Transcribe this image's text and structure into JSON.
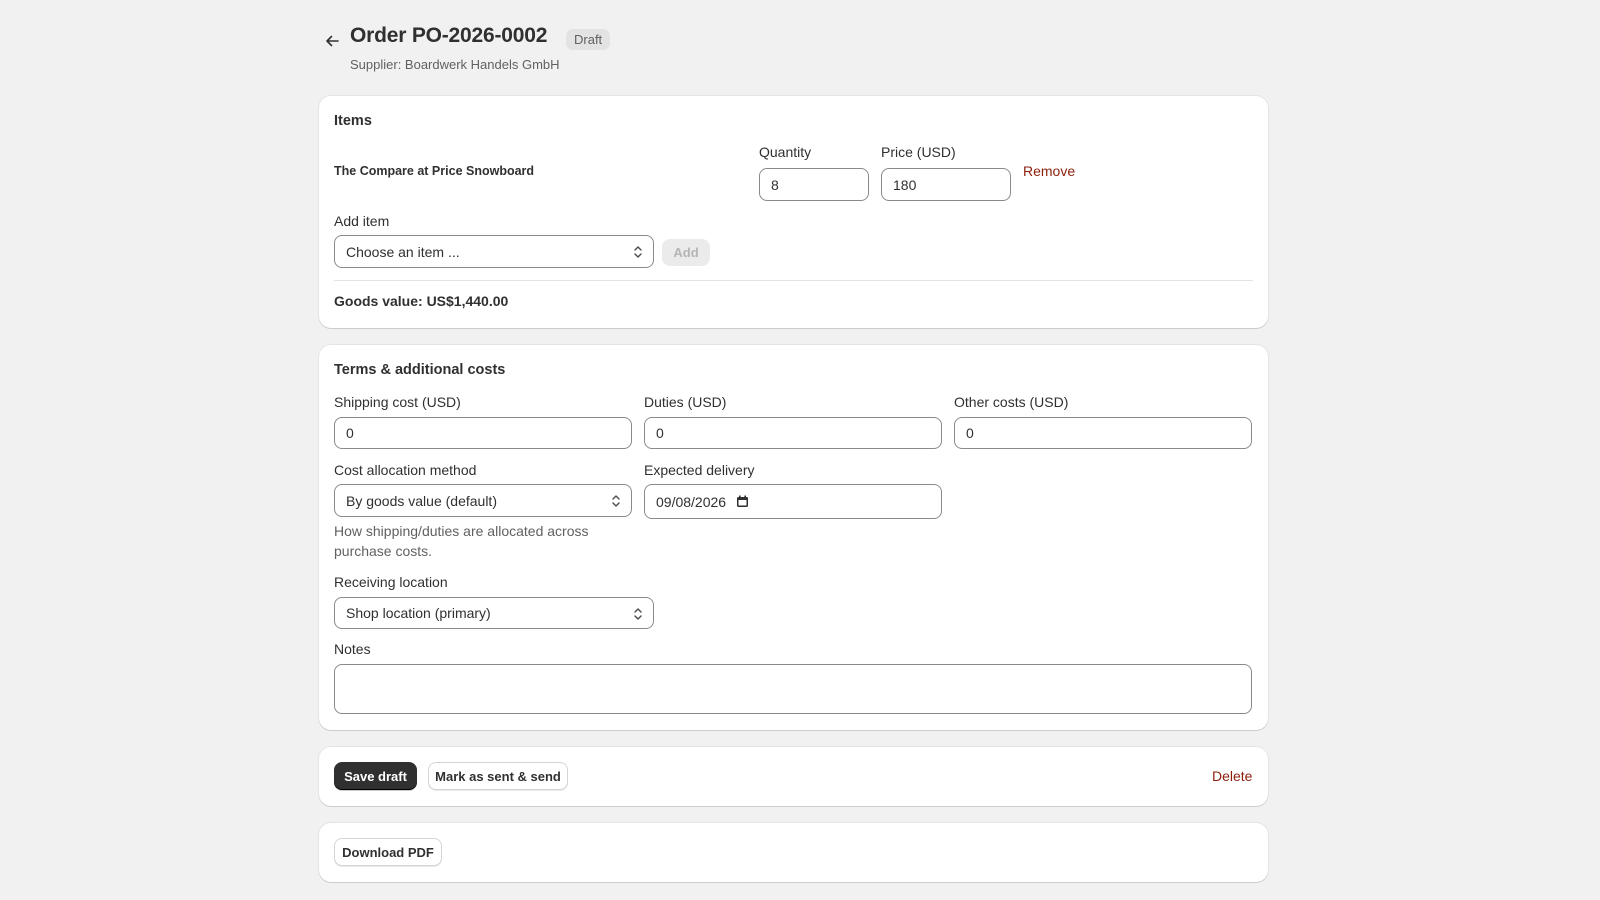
{
  "header": {
    "title": "Order PO-2026-0002",
    "status_badge": "Draft",
    "supplier": "Supplier: Boardwerk Handels GmbH"
  },
  "items_card": {
    "title": "Items",
    "line_items": [
      {
        "name": "The Compare at Price Snowboard",
        "quantity_label": "Quantity",
        "quantity": "8",
        "price_label": "Price (USD)",
        "price": "180",
        "remove_label": "Remove"
      }
    ],
    "add_item_label": "Add item",
    "add_item_select": "Choose an item ...",
    "add_button": "Add",
    "goods_value": "Goods value: US$1,440.00"
  },
  "terms_card": {
    "title": "Terms & additional costs",
    "shipping_label": "Shipping cost (USD)",
    "shipping_value": "0",
    "duties_label": "Duties (USD)",
    "duties_value": "0",
    "other_label": "Other costs (USD)",
    "other_value": "0",
    "allocation_label": "Cost allocation method",
    "allocation_value": "By goods value (default)",
    "allocation_help": "How shipping/duties are allocated across purchase costs.",
    "delivery_label": "Expected delivery",
    "delivery_value": "09/08/2026",
    "location_label": "Receiving location",
    "location_value": "Shop location (primary)",
    "notes_label": "Notes",
    "notes_value": ""
  },
  "actions_card": {
    "save_draft": "Save draft",
    "mark_sent": "Mark as sent & send",
    "delete": "Delete"
  },
  "pdf_card": {
    "download_pdf": "Download PDF"
  },
  "icons": {
    "back": "arrow-left-icon",
    "select_chevron": "chevron-up-down-icon",
    "calendar": "calendar-icon"
  },
  "colors": {
    "background": "#f1f1f1",
    "card": "#ffffff",
    "primary_button": "#303030",
    "danger": "#8e1f0b",
    "badge_bg": "#e3e3e3"
  }
}
